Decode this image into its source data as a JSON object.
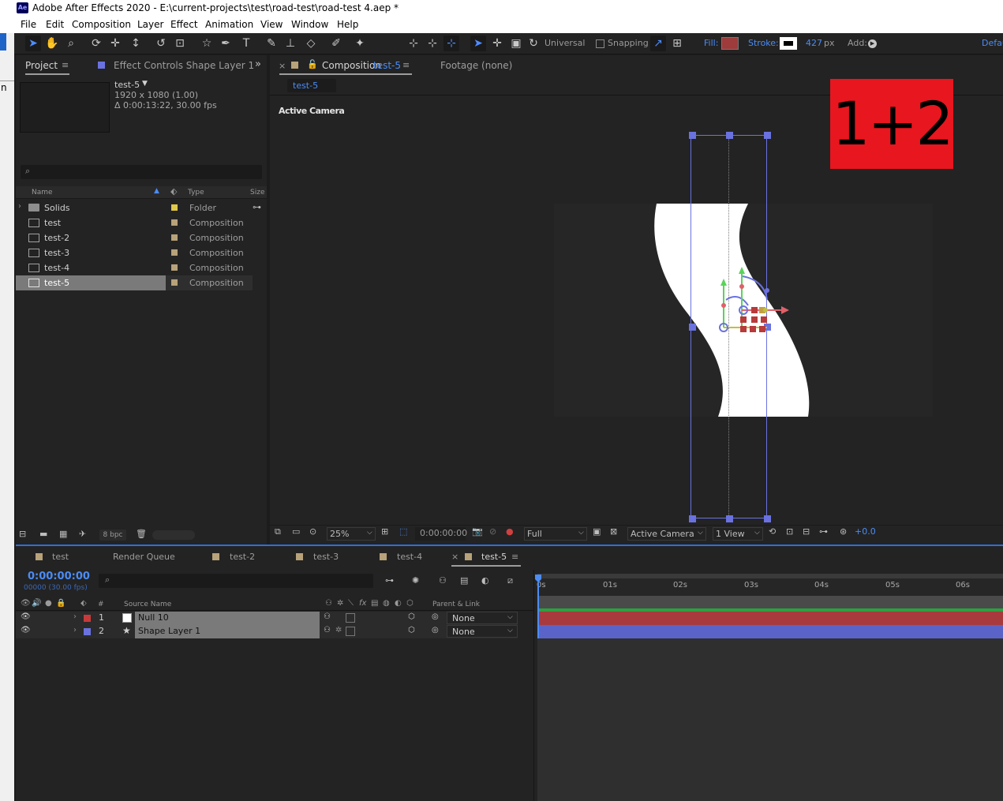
{
  "app": {
    "logo": "Ae",
    "title": "Adobe After Effects 2020 - E:\\current-projects\\test\\road-test\\road-test 4.aep *"
  },
  "menu": [
    "File",
    "Edit",
    "Composition",
    "Layer",
    "Effect",
    "Animation",
    "View",
    "Window",
    "Help"
  ],
  "side_fragment": "n",
  "toolbar": {
    "universal": "Universal",
    "snapping": "Snapping",
    "fill_label": "Fill:",
    "stroke_label": "Stroke:",
    "stroke_width": "427",
    "stroke_unit": "px",
    "add_label": "Add:",
    "workspace": "Defau",
    "fill_color": "#9e3b3b",
    "stroke_color": "#ffffff"
  },
  "project_panel": {
    "tab_project": "Project",
    "tab_effect_controls": "Effect Controls Shape Layer 1",
    "comp_name": "test-5",
    "comp_res": "1920 x 1080 (1.00)",
    "comp_duration": "Δ 0:00:13:22, 30.00 fps",
    "col_name": "Name",
    "col_type": "Type",
    "col_size": "Size",
    "items": [
      {
        "name": "Solids",
        "type": "Folder",
        "label_color": "#e0c84a"
      },
      {
        "name": "test",
        "type": "Composition",
        "label_color": "#b8a27a"
      },
      {
        "name": "test-2",
        "type": "Composition",
        "label_color": "#b8a27a"
      },
      {
        "name": "test-3",
        "type": "Composition",
        "label_color": "#b8a27a"
      },
      {
        "name": "test-4",
        "type": "Composition",
        "label_color": "#b8a27a"
      },
      {
        "name": "test-5",
        "type": "Composition",
        "label_color": "#b8a27a"
      }
    ],
    "bpc": "8 bpc"
  },
  "viewer": {
    "tab_comp_prefix": "Composition",
    "tab_comp_name": "test-5",
    "tab_footage": "Footage  (none)",
    "breadcrumb": "test-5",
    "camera_label": "Active Camera",
    "badge_text": "1+2",
    "badge_color": "#e8161e",
    "zoom": "25%",
    "timecode": "0:00:00:00",
    "resolution": "Full",
    "camera": "Active Camera",
    "views": "1 View",
    "exposure": "+0.0"
  },
  "timeline": {
    "tabs": [
      "test",
      "Render Queue",
      "test-2",
      "test-3",
      "test-4",
      "test-5"
    ],
    "current_time": "0:00:00:00",
    "frame_info": "00000 (30.00 fps)",
    "col_source_name": "Source Name",
    "col_parent": "Parent & Link",
    "col_num": "#",
    "layers": [
      {
        "num": "1",
        "name": "Null 10",
        "label_color": "#c83a3a",
        "parent": "None",
        "bar_color": "#a83a3e"
      },
      {
        "num": "2",
        "name": "Shape Layer 1",
        "label_color": "#6a72e0",
        "parent": "None",
        "bar_color": "#5a64c8"
      }
    ],
    "ruler": [
      "0s",
      "01s",
      "02s",
      "03s",
      "04s",
      "05s",
      "06s"
    ]
  }
}
